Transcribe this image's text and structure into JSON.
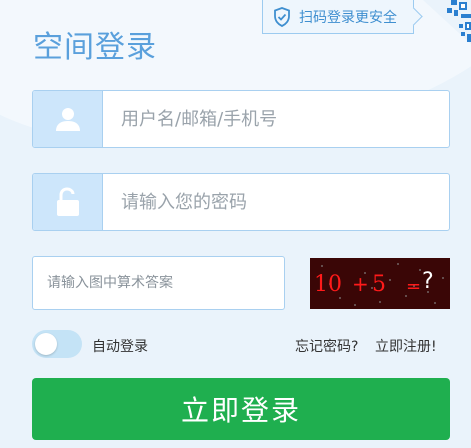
{
  "title": "空间登录",
  "qr_tip": {
    "label": "扫码登录更安全"
  },
  "username": {
    "placeholder": "用户名/邮箱/手机号",
    "value": ""
  },
  "password": {
    "placeholder": "请输入您的密码",
    "value": ""
  },
  "captcha": {
    "placeholder": "请输入图中算术答案",
    "value": "",
    "image_text": [
      "10",
      "+",
      "5",
      "=",
      "?"
    ]
  },
  "auto_login": {
    "label": "自动登录",
    "checked": false
  },
  "links": {
    "forgot": "忘记密码?",
    "register": "立即注册!"
  },
  "login_button": {
    "label": "立即登录"
  },
  "icons": {
    "user": "user-icon",
    "lock": "lock-icon",
    "shield": "shield-check-icon",
    "qr": "qr-code-icon"
  },
  "colors": {
    "accent": "#5aa0dc",
    "input_border": "#a9d0f0",
    "icon_bg": "#cde6fb",
    "login_button": "#1faf4f",
    "captcha_bg": "#3a0606",
    "captcha_text": "#ff1a1a"
  }
}
